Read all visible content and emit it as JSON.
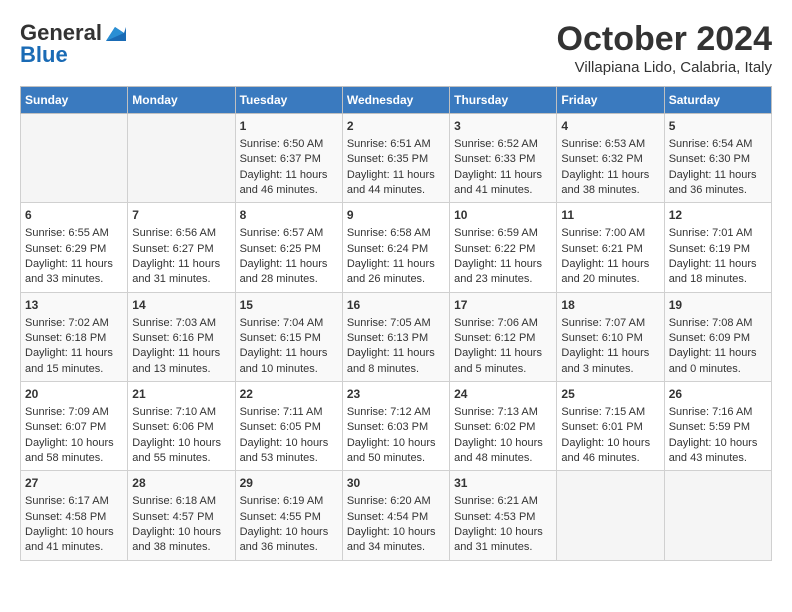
{
  "header": {
    "logo_general": "General",
    "logo_blue": "Blue",
    "month_title": "October 2024",
    "location": "Villapiana Lido, Calabria, Italy"
  },
  "days_of_week": [
    "Sunday",
    "Monday",
    "Tuesday",
    "Wednesday",
    "Thursday",
    "Friday",
    "Saturday"
  ],
  "weeks": [
    [
      {
        "day": "",
        "content": ""
      },
      {
        "day": "",
        "content": ""
      },
      {
        "day": "1",
        "content": "Sunrise: 6:50 AM\nSunset: 6:37 PM\nDaylight: 11 hours and 46 minutes."
      },
      {
        "day": "2",
        "content": "Sunrise: 6:51 AM\nSunset: 6:35 PM\nDaylight: 11 hours and 44 minutes."
      },
      {
        "day": "3",
        "content": "Sunrise: 6:52 AM\nSunset: 6:33 PM\nDaylight: 11 hours and 41 minutes."
      },
      {
        "day": "4",
        "content": "Sunrise: 6:53 AM\nSunset: 6:32 PM\nDaylight: 11 hours and 38 minutes."
      },
      {
        "day": "5",
        "content": "Sunrise: 6:54 AM\nSunset: 6:30 PM\nDaylight: 11 hours and 36 minutes."
      }
    ],
    [
      {
        "day": "6",
        "content": "Sunrise: 6:55 AM\nSunset: 6:29 PM\nDaylight: 11 hours and 33 minutes."
      },
      {
        "day": "7",
        "content": "Sunrise: 6:56 AM\nSunset: 6:27 PM\nDaylight: 11 hours and 31 minutes."
      },
      {
        "day": "8",
        "content": "Sunrise: 6:57 AM\nSunset: 6:25 PM\nDaylight: 11 hours and 28 minutes."
      },
      {
        "day": "9",
        "content": "Sunrise: 6:58 AM\nSunset: 6:24 PM\nDaylight: 11 hours and 26 minutes."
      },
      {
        "day": "10",
        "content": "Sunrise: 6:59 AM\nSunset: 6:22 PM\nDaylight: 11 hours and 23 minutes."
      },
      {
        "day": "11",
        "content": "Sunrise: 7:00 AM\nSunset: 6:21 PM\nDaylight: 11 hours and 20 minutes."
      },
      {
        "day": "12",
        "content": "Sunrise: 7:01 AM\nSunset: 6:19 PM\nDaylight: 11 hours and 18 minutes."
      }
    ],
    [
      {
        "day": "13",
        "content": "Sunrise: 7:02 AM\nSunset: 6:18 PM\nDaylight: 11 hours and 15 minutes."
      },
      {
        "day": "14",
        "content": "Sunrise: 7:03 AM\nSunset: 6:16 PM\nDaylight: 11 hours and 13 minutes."
      },
      {
        "day": "15",
        "content": "Sunrise: 7:04 AM\nSunset: 6:15 PM\nDaylight: 11 hours and 10 minutes."
      },
      {
        "day": "16",
        "content": "Sunrise: 7:05 AM\nSunset: 6:13 PM\nDaylight: 11 hours and 8 minutes."
      },
      {
        "day": "17",
        "content": "Sunrise: 7:06 AM\nSunset: 6:12 PM\nDaylight: 11 hours and 5 minutes."
      },
      {
        "day": "18",
        "content": "Sunrise: 7:07 AM\nSunset: 6:10 PM\nDaylight: 11 hours and 3 minutes."
      },
      {
        "day": "19",
        "content": "Sunrise: 7:08 AM\nSunset: 6:09 PM\nDaylight: 11 hours and 0 minutes."
      }
    ],
    [
      {
        "day": "20",
        "content": "Sunrise: 7:09 AM\nSunset: 6:07 PM\nDaylight: 10 hours and 58 minutes."
      },
      {
        "day": "21",
        "content": "Sunrise: 7:10 AM\nSunset: 6:06 PM\nDaylight: 10 hours and 55 minutes."
      },
      {
        "day": "22",
        "content": "Sunrise: 7:11 AM\nSunset: 6:05 PM\nDaylight: 10 hours and 53 minutes."
      },
      {
        "day": "23",
        "content": "Sunrise: 7:12 AM\nSunset: 6:03 PM\nDaylight: 10 hours and 50 minutes."
      },
      {
        "day": "24",
        "content": "Sunrise: 7:13 AM\nSunset: 6:02 PM\nDaylight: 10 hours and 48 minutes."
      },
      {
        "day": "25",
        "content": "Sunrise: 7:15 AM\nSunset: 6:01 PM\nDaylight: 10 hours and 46 minutes."
      },
      {
        "day": "26",
        "content": "Sunrise: 7:16 AM\nSunset: 5:59 PM\nDaylight: 10 hours and 43 minutes."
      }
    ],
    [
      {
        "day": "27",
        "content": "Sunrise: 6:17 AM\nSunset: 4:58 PM\nDaylight: 10 hours and 41 minutes."
      },
      {
        "day": "28",
        "content": "Sunrise: 6:18 AM\nSunset: 4:57 PM\nDaylight: 10 hours and 38 minutes."
      },
      {
        "day": "29",
        "content": "Sunrise: 6:19 AM\nSunset: 4:55 PM\nDaylight: 10 hours and 36 minutes."
      },
      {
        "day": "30",
        "content": "Sunrise: 6:20 AM\nSunset: 4:54 PM\nDaylight: 10 hours and 34 minutes."
      },
      {
        "day": "31",
        "content": "Sunrise: 6:21 AM\nSunset: 4:53 PM\nDaylight: 10 hours and 31 minutes."
      },
      {
        "day": "",
        "content": ""
      },
      {
        "day": "",
        "content": ""
      }
    ]
  ]
}
